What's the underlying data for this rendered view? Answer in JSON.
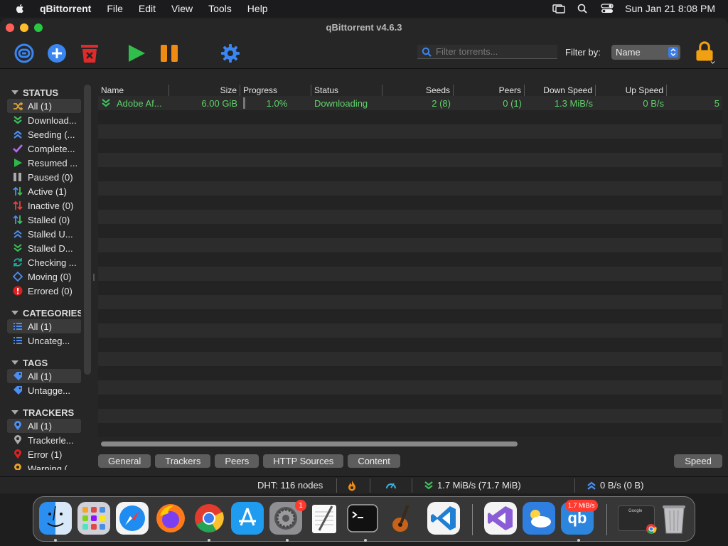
{
  "menubar": {
    "app_name": "qBittorrent",
    "items": [
      "File",
      "Edit",
      "View",
      "Tools",
      "Help"
    ],
    "clock": "Sun Jan 21  8:08 PM"
  },
  "window": {
    "title": "qBittorrent v4.6.3"
  },
  "toolbar": {
    "search_placeholder": "Filter torrents...",
    "filter_label": "Filter by:",
    "filter_value": "Name"
  },
  "sidebar": {
    "status_header": "STATUS",
    "status_items": [
      {
        "label": "All (1)",
        "icon": "shuffle-icon",
        "color": "#e0a030"
      },
      {
        "label": "Download...",
        "icon": "download-icon",
        "color": "#3cc25a"
      },
      {
        "label": "Seeding (...",
        "icon": "upload-icon",
        "color": "#4a8ff5"
      },
      {
        "label": "Complete...",
        "icon": "check-icon",
        "color": "#b56cf0"
      },
      {
        "label": "Resumed ...",
        "icon": "play-icon",
        "color": "#2fb84a"
      },
      {
        "label": "Paused (0)",
        "icon": "pause-icon",
        "color": "#aaaaaa"
      },
      {
        "label": "Active (1)",
        "icon": "active-icon",
        "color": "#4a8ff5"
      },
      {
        "label": "Inactive (0)",
        "icon": "inactive-icon",
        "color": "#e84040"
      },
      {
        "label": "Stalled (0)",
        "icon": "stalled-icon",
        "color": "#4a8ff5"
      },
      {
        "label": "Stalled U...",
        "icon": "stalled-upload-icon",
        "color": "#4a8ff5"
      },
      {
        "label": "Stalled D...",
        "icon": "stalled-download-icon",
        "color": "#3cc25a"
      },
      {
        "label": "Checking ...",
        "icon": "checking-icon",
        "color": "#20b0a0"
      },
      {
        "label": "Moving (0)",
        "icon": "moving-icon",
        "color": "#4a8ff5"
      },
      {
        "label": "Errored (0)",
        "icon": "error-icon",
        "color": "#e02020"
      }
    ],
    "categories_header": "CATEGORIES",
    "category_items": [
      {
        "label": "All (1)",
        "icon": "list-icon",
        "color": "#4a8ff5"
      },
      {
        "label": "Uncateg...",
        "icon": "list-icon",
        "color": "#4a8ff5"
      }
    ],
    "tags_header": "TAGS",
    "tag_items": [
      {
        "label": "All (1)",
        "icon": "tag-icon",
        "color": "#4a8ff5"
      },
      {
        "label": "Untagge...",
        "icon": "tag-icon",
        "color": "#4a8ff5"
      }
    ],
    "trackers_header": "TRACKERS",
    "tracker_items": [
      {
        "label": "All (1)",
        "icon": "pin-icon",
        "color": "#4a8ff5"
      },
      {
        "label": "Trackerle...",
        "icon": "pin-icon",
        "color": "#aaaaaa"
      },
      {
        "label": "Error (1)",
        "icon": "pin-icon",
        "color": "#e02020"
      },
      {
        "label": "Warning (...",
        "icon": "pin-icon",
        "color": "#f0a020"
      }
    ]
  },
  "table": {
    "columns": [
      "Name",
      "Size",
      "Progress",
      "Status",
      "Seeds",
      "Peers",
      "Down Speed",
      "Up Speed"
    ],
    "rows": [
      {
        "name": "Adobe Af...",
        "size": "6.00 GiB",
        "progress": "1.0%",
        "progress_value": 0.01,
        "status": "Downloading",
        "seeds": "2 (8)",
        "peers": "0 (1)",
        "down_speed": "1.3 MiB/s",
        "up_speed": "0 B/s",
        "extra": "5"
      }
    ],
    "empty_rows": 23
  },
  "tabs": [
    "General",
    "Trackers",
    "Peers",
    "HTTP Sources",
    "Content"
  ],
  "speed_tab": "Speed",
  "statusbar": {
    "dht": "DHT: 116 nodes",
    "download": "1.7 MiB/s (71.7 MiB)",
    "upload": "0 B/s (0 B)"
  },
  "dock": {
    "settings_badge": "1",
    "qbit_badge": "1.7 MiB/s",
    "qbit_label": "qb",
    "preview_label": "Google"
  }
}
